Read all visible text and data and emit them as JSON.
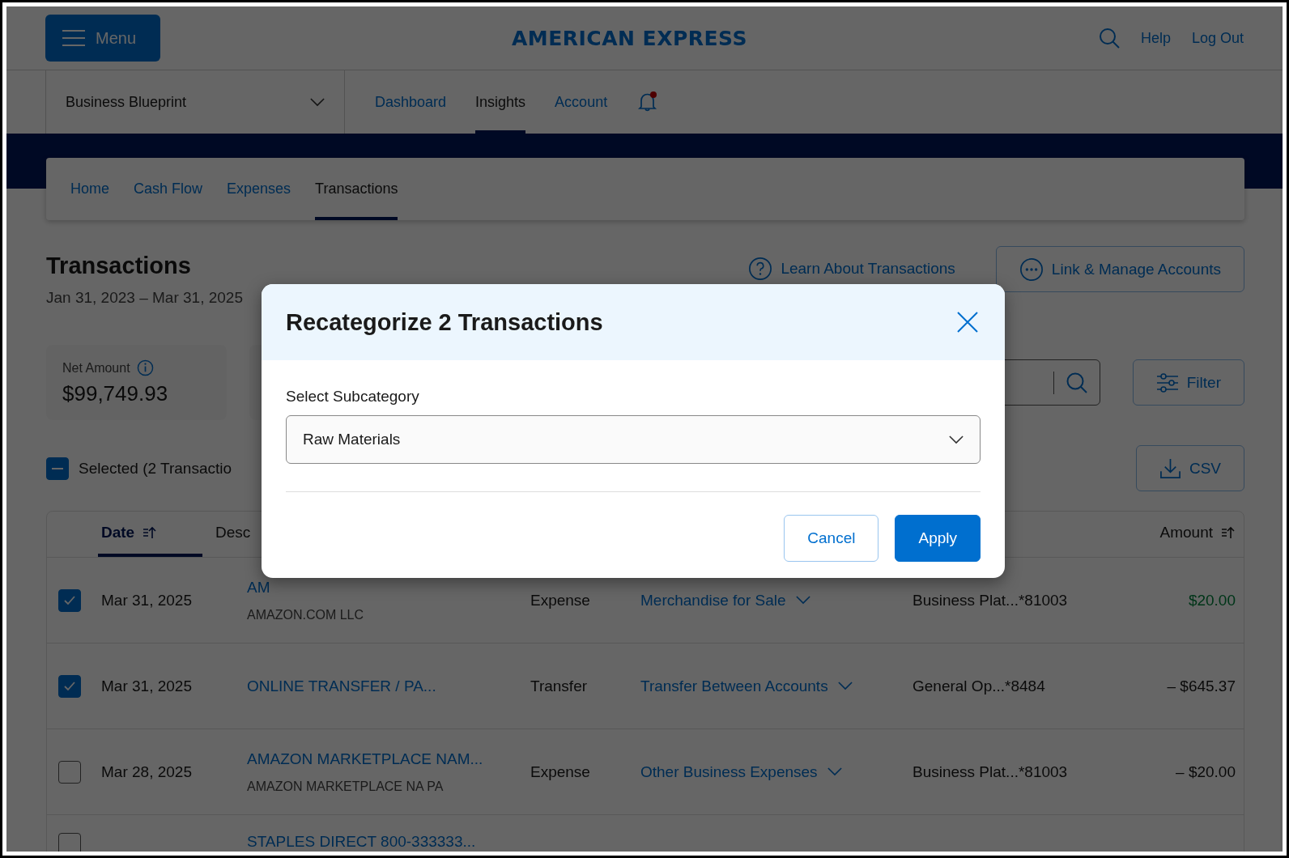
{
  "header": {
    "menu_label": "Menu",
    "logo": "AMERICAN EXPRESS",
    "links": [
      "Help",
      "Log Out"
    ]
  },
  "account_select": {
    "value": "Business Blueprint"
  },
  "main_nav": [
    {
      "label": "Dashboard",
      "selected": false
    },
    {
      "label": "Insights",
      "selected": true
    },
    {
      "label": "Account",
      "selected": false
    }
  ],
  "notifications": {
    "unread": true
  },
  "sub_nav": [
    {
      "label": "Home",
      "selected": false
    },
    {
      "label": "Cash Flow",
      "selected": false
    },
    {
      "label": "Expenses",
      "selected": false
    },
    {
      "label": "Transactions",
      "selected": true
    }
  ],
  "page": {
    "title": "Transactions",
    "date_range": "Jan 31, 2023 – Mar 31, 2025",
    "learn_link": "Learn About Transactions",
    "manage_button": "Link & Manage Accounts"
  },
  "stats": [
    {
      "label": "Net Amount",
      "value": "$99,749.93"
    }
  ],
  "tools": {
    "filter_label": "Filter",
    "csv_label": "CSV"
  },
  "selection": {
    "label": "Selected (2 Transactio",
    "indeterminate": true
  },
  "table": {
    "columns": [
      {
        "label": "Date",
        "selected": true
      },
      {
        "label": "Desc",
        "selected": false
      },
      {
        "label": "Amount",
        "selected": false
      }
    ],
    "rows": [
      {
        "checked": true,
        "date": "Mar 31, 2025",
        "description": "AM",
        "merchant": "AMAZON.COM LLC",
        "type": "Expense",
        "category": "Merchandise for Sale",
        "account": "Business Plat...*81003",
        "amount": "$20.00",
        "kind": "credit"
      },
      {
        "checked": true,
        "date": "Mar 31, 2025",
        "description": "ONLINE TRANSFER / PA...",
        "type": "Transfer",
        "category": "Transfer Between Accounts",
        "account": "General Op...*8484",
        "amount": "– $645.37",
        "kind": "debit"
      },
      {
        "checked": false,
        "date": "Mar 28, 2025",
        "description": "AMAZON MARKETPLACE NAM...",
        "merchant": "AMAZON MARKETPLACE NA PA",
        "type": "Expense",
        "category": "Other Business Expenses",
        "account": "Business Plat...*81003",
        "amount": "– $20.00",
        "kind": "debit"
      },
      {
        "checked": false,
        "description": "STAPLES DIRECT 800-333333..."
      }
    ]
  },
  "dialog": {
    "title": "Recategorize 2 Transactions",
    "field_label": "Select Subcategory",
    "value": "Raw Materials",
    "buttons": [
      {
        "label": "Cancel",
        "kind": "secondary"
      },
      {
        "label": "Apply",
        "kind": "primary"
      }
    ]
  }
}
